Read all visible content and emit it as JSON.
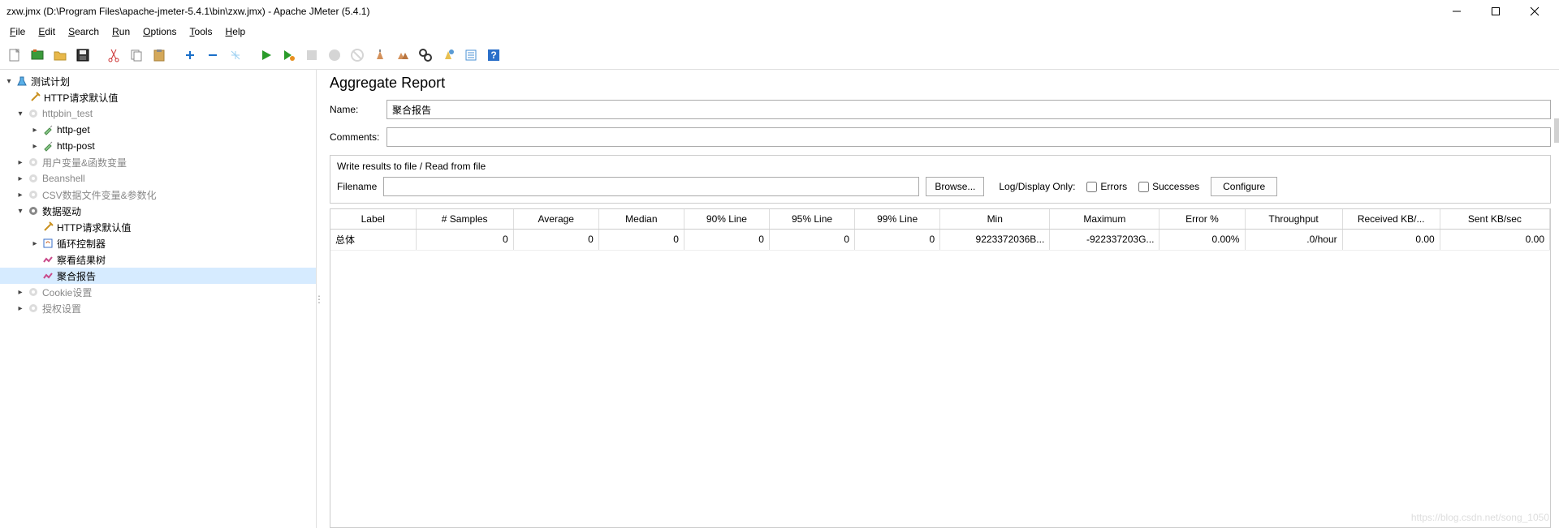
{
  "window": {
    "title": "zxw.jmx (D:\\Program Files\\apache-jmeter-5.4.1\\bin\\zxw.jmx) - Apache JMeter (5.4.1)"
  },
  "menu": {
    "file": "File",
    "edit": "Edit",
    "search": "Search",
    "run": "Run",
    "options": "Options",
    "tools": "Tools",
    "help": "Help"
  },
  "tree": {
    "root": "测试计划",
    "http_defaults": "HTTP请求默认值",
    "httpbin": "httpbin_test",
    "http_get": "http-get",
    "http_post": "http-post",
    "user_vars": "用户变量&函数变量",
    "beanshell": "Beanshell",
    "csv": "CSV数据文件变量&参数化",
    "data_driven": "数据驱动",
    "dd_http_defaults": "HTTP请求默认值",
    "loop_ctrl": "循环控制器",
    "view_results": "察看结果树",
    "agg_report": "聚合报告",
    "cookie": "Cookie设置",
    "auth": "授权设置"
  },
  "panel": {
    "title": "Aggregate Report",
    "name_label": "Name:",
    "name_value": "聚合报告",
    "comments_label": "Comments:",
    "comments_value": "",
    "file_section_title": "Write results to file / Read from file",
    "filename_label": "Filename",
    "filename_value": "",
    "browse": "Browse...",
    "log_display": "Log/Display Only:",
    "errors": "Errors",
    "successes": "Successes",
    "configure": "Configure"
  },
  "table": {
    "headers": [
      "Label",
      "# Samples",
      "Average",
      "Median",
      "90% Line",
      "95% Line",
      "99% Line",
      "Min",
      "Maximum",
      "Error %",
      "Throughput",
      "Received KB/...",
      "Sent KB/sec"
    ],
    "rows": [
      {
        "label": "总体",
        "samples": "0",
        "average": "0",
        "median": "0",
        "p90": "0",
        "p95": "0",
        "p99": "0",
        "min": "9223372036B...",
        "max": "-922337203G...",
        "error": "0.00%",
        "throughput": ".0/hour",
        "recv": "0.00",
        "sent": "0.00"
      }
    ]
  },
  "watermark": "https://blog.csdn.net/song_1050"
}
